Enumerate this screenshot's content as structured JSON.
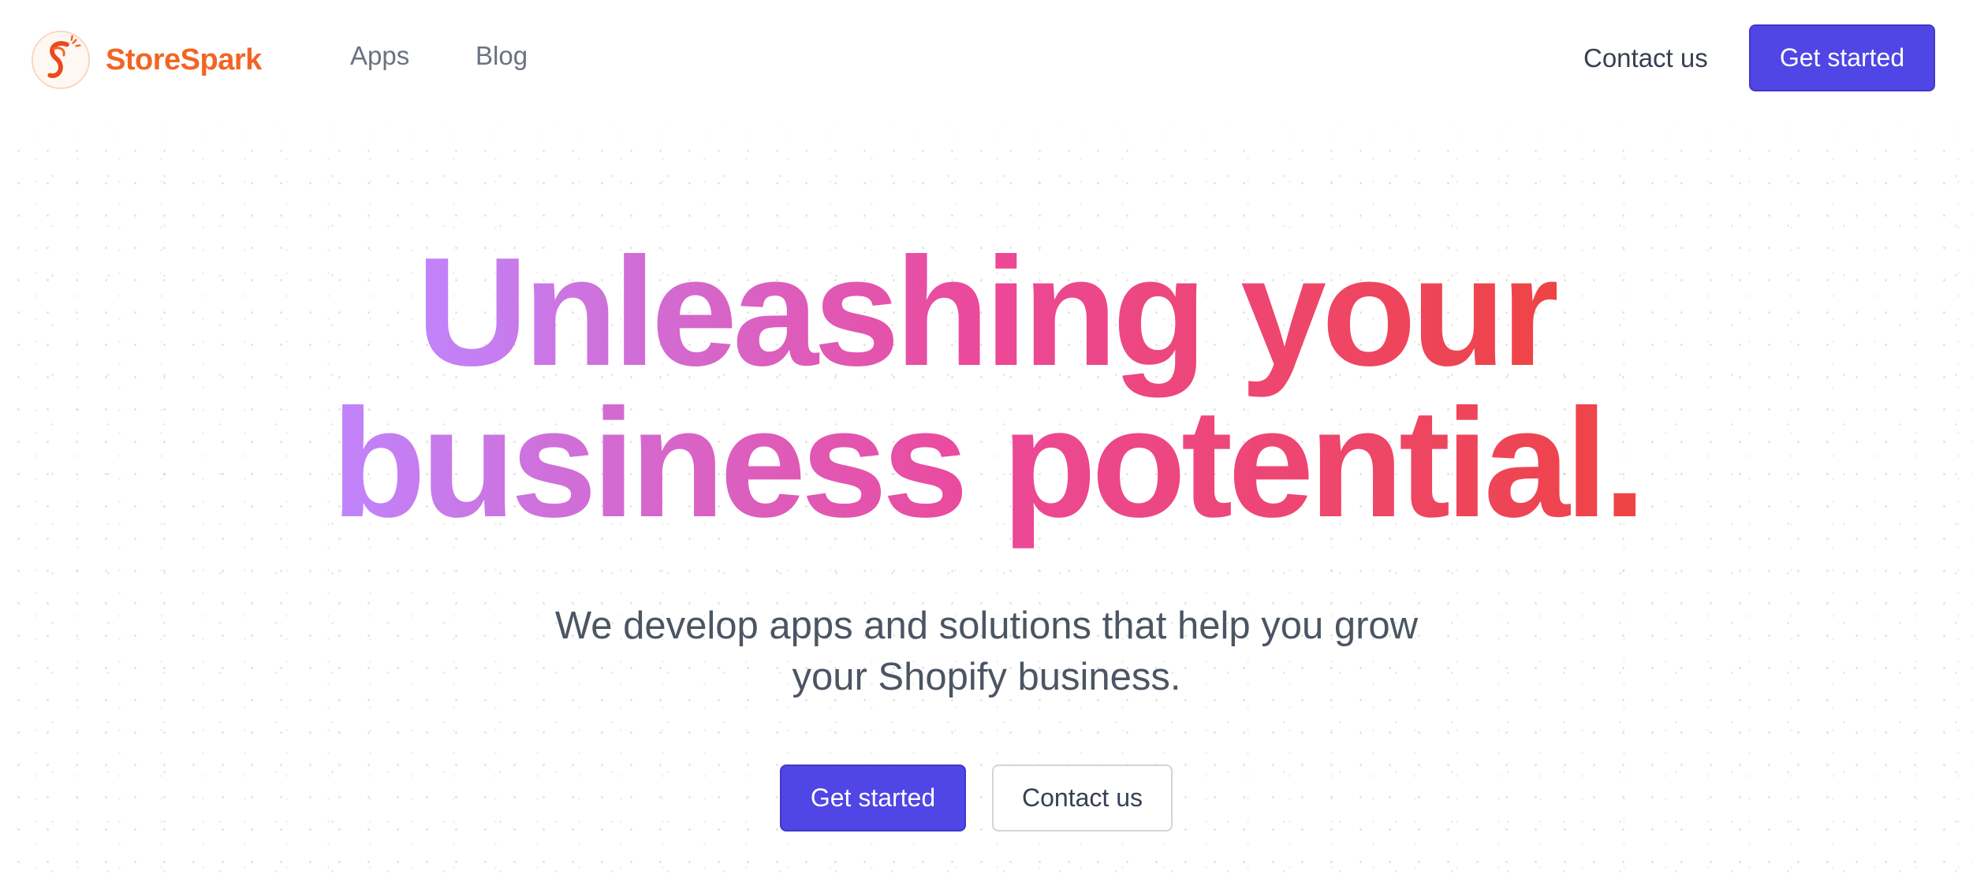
{
  "brand": {
    "name": "StoreSpark",
    "color": "#f26524"
  },
  "nav": {
    "items": [
      {
        "label": "Apps"
      },
      {
        "label": "Blog"
      }
    ]
  },
  "header": {
    "contact_label": "Contact us",
    "cta_label": "Get started"
  },
  "hero": {
    "title_lines": [
      "Unleashing your",
      "business potential."
    ],
    "title_gradient": [
      "#c084fc",
      "#ec4899",
      "#ef4444"
    ],
    "subtitle_lines": [
      "We develop apps and solutions that help you grow",
      "your Shopify business."
    ],
    "primary_label": "Get started",
    "secondary_label": "Contact us"
  },
  "colors": {
    "accent": "#4f46e5",
    "text_muted": "#6b7280",
    "text_body": "#4b5563"
  },
  "icons": {
    "logo": "storespark-logo-icon"
  }
}
